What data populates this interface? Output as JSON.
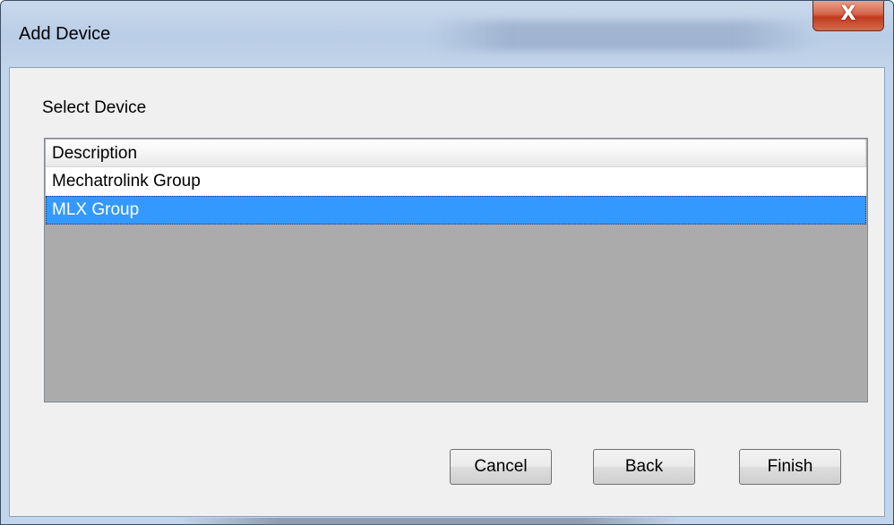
{
  "window": {
    "title": "Add Device",
    "close_glyph": "X"
  },
  "dialog": {
    "section_label": "Select Device",
    "list": {
      "columns": [
        "Description"
      ],
      "rows": [
        {
          "description": "Mechatrolink Group",
          "selected": false
        },
        {
          "description": "MLX Group",
          "selected": true
        }
      ]
    },
    "buttons": {
      "cancel": "Cancel",
      "back": "Back",
      "finish": "Finish"
    }
  },
  "colors": {
    "selection": "#3399ff",
    "list_empty_area": "#ababab",
    "client_background": "#f0f0f0",
    "close_button": "#c13a1e"
  }
}
